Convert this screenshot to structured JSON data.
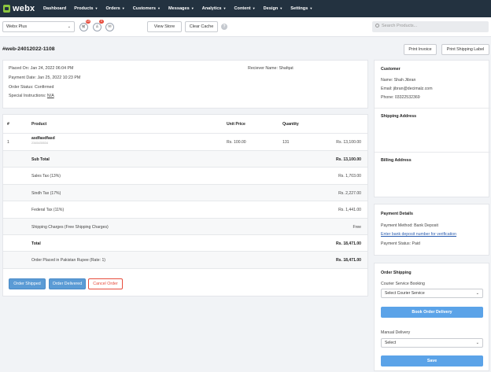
{
  "brand": {
    "name": "webx"
  },
  "nav": [
    {
      "label": "Dashboard",
      "caret": false
    },
    {
      "label": "Products",
      "caret": true
    },
    {
      "label": "Orders",
      "caret": true
    },
    {
      "label": "Customers",
      "caret": true
    },
    {
      "label": "Messages",
      "caret": true
    },
    {
      "label": "Analytics",
      "caret": true
    },
    {
      "label": "Content",
      "caret": true
    },
    {
      "label": "Design",
      "caret": true
    },
    {
      "label": "Settings",
      "caret": true
    }
  ],
  "toolbar": {
    "store_selected": "Webx Plus",
    "cart_badge": "19",
    "user_badge": "0",
    "view_store": "View Store",
    "clear_cache": "Clear Cache",
    "help": "?",
    "search_placeholder": "Search Products..."
  },
  "order": {
    "id": "#web-24012022-1108",
    "print_invoice": "Print Invoice",
    "print_shipping_label": "Print Shipping Label",
    "placed_on": "Placed On: Jan 24, 2022 06:04 PM",
    "payment_date": "Payment Date: Jan 25, 2022 10:23 PM",
    "status": "Order Status: Confirmed",
    "special_label": "Special Instructions:",
    "special_value": "N/A",
    "receiver": "Reciever Name: Shafqat"
  },
  "table": {
    "headers": {
      "num": "#",
      "product": "Product",
      "unit_price": "Unit Price",
      "quantity": "Quantity"
    },
    "items": [
      {
        "num": "1",
        "name": "asdfasdfasd",
        "sku": "2345435534",
        "unit_price": "Rs. 100.00",
        "quantity": "131",
        "total": "Rs. 13,100.00"
      }
    ],
    "summary": [
      {
        "label": "Sub Total",
        "value": "Rs. 13,100.00",
        "bold": true,
        "shaded": true
      },
      {
        "label": "Sales Tax (13%)",
        "value": "Rs. 1,703.00",
        "bold": false,
        "shaded": false
      },
      {
        "label": "Sindh Tax (17%)",
        "value": "Rs. 2,227.00",
        "bold": false,
        "shaded": true
      },
      {
        "label": "Federal Tax (11%)",
        "value": "Rs. 1,441.00",
        "bold": false,
        "shaded": false
      },
      {
        "label": "Shipping Charges (Free Shipping Charges)",
        "value": "Free",
        "bold": false,
        "shaded": true
      },
      {
        "label": "Total",
        "value": "Rs. 18,471.00",
        "bold": true,
        "shaded": false
      },
      {
        "label": "Order Placed in Pakistan Rupee (Rate: 1)",
        "value": "Rs. 18,471.00",
        "bold": false,
        "shaded": true,
        "value_bold": true
      }
    ]
  },
  "actions": {
    "shipped": "Order Shipped",
    "delivered": "Order Delivered",
    "cancel": "Cancel Order"
  },
  "customer": {
    "heading": "Customer",
    "name": "Name: Shah Jibran",
    "email": "Email: jibran@decimalz.com",
    "phone": "Phone: 03322532369",
    "shipping_heading": "Shipping Address",
    "billing_heading": "Billing Address"
  },
  "payment": {
    "heading": "Payment Details",
    "method": "Payment Method: Bank Deposit",
    "link": "Enter bank deposit number for verification",
    "status": "Payment Status: Paid"
  },
  "shipping": {
    "heading": "Order Shipping",
    "courier_label": "Courier Service Booking",
    "courier_select": "Select Courier Service",
    "book_button": "Book Order Delivery",
    "manual_label": "Manual Delivery",
    "manual_select": "Select",
    "save_button": "Save"
  },
  "colors": {
    "nav_bg": "#233240",
    "brand_green": "#8cc63f",
    "primary": "#5b9bd5",
    "danger": "#e74c3c",
    "link": "#2a5db0"
  }
}
